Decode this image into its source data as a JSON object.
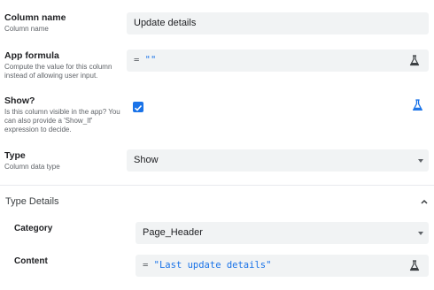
{
  "column_name": {
    "title": "Column name",
    "description": "Column name",
    "value": "Update details"
  },
  "app_formula": {
    "title": "App formula",
    "description": "Compute the value for this column instead of allowing user input.",
    "operator": "=",
    "value": "\"\"",
    "icon": "flask-icon"
  },
  "show": {
    "title": "Show?",
    "description": "Is this column visible in the app? You can also provide a 'Show_If' expression to decide.",
    "checked": true,
    "icon": "flask-icon"
  },
  "type": {
    "title": "Type",
    "description": "Column data type",
    "value": "Show"
  },
  "type_details": {
    "title": "Type Details",
    "expanded": true,
    "category": {
      "label": "Category",
      "value": "Page_Header"
    },
    "content": {
      "label": "Content",
      "operator": "=",
      "value": "\"Last update details\""
    }
  },
  "colors": {
    "accent": "#1a73e8",
    "field_bg": "#f1f3f4"
  }
}
